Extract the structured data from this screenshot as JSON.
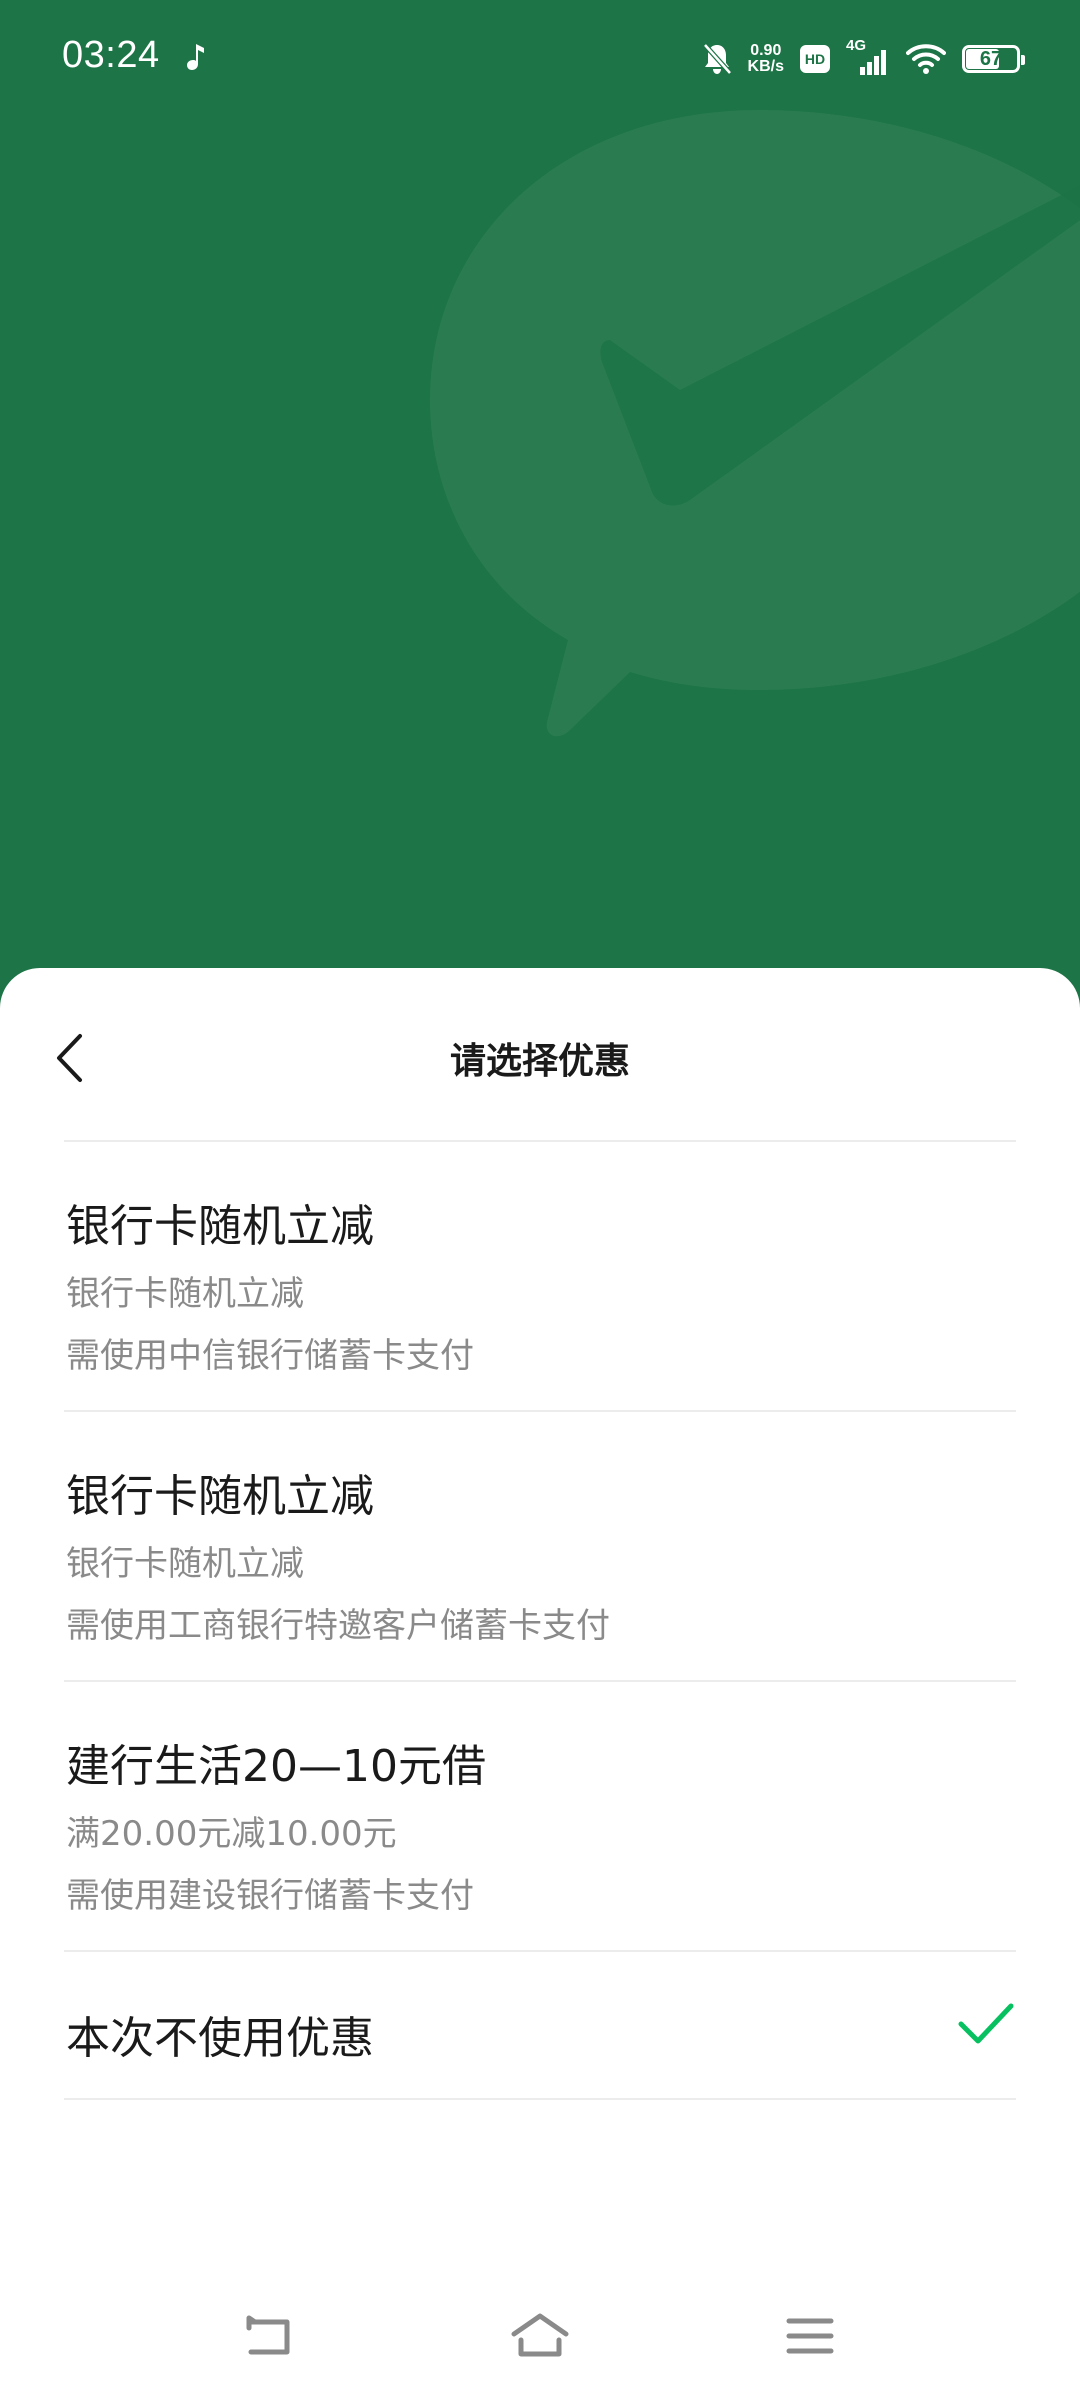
{
  "status_bar": {
    "time": "03:24",
    "net_speed_value": "0.90",
    "net_speed_unit": "KB/s",
    "hd": "HD",
    "network": "4G",
    "battery": "67",
    "battery_level": 0.67
  },
  "sheet": {
    "title": "请选择优惠"
  },
  "options": [
    {
      "title": "银行卡随机立减",
      "subtitle": "银行卡随机立减",
      "condition": "需使用中信银行储蓄卡支付"
    },
    {
      "title": "银行卡随机立减",
      "subtitle": "银行卡随机立减",
      "condition": "需使用工商银行特邀客户储蓄卡支付"
    },
    {
      "title": "建行生活20—10元借",
      "subtitle": "满20.00元减10.00元",
      "condition": "需使用建设银行储蓄卡支付"
    }
  ],
  "no_discount": {
    "title": "本次不使用优惠",
    "selected": true
  },
  "colors": {
    "brand_green": "#1d7446",
    "check_green": "#07c160"
  },
  "icons": {
    "back": "chevron-left-icon",
    "check": "check-icon",
    "nav_back": "nav-back-icon",
    "nav_home": "nav-home-icon",
    "nav_menu": "nav-menu-icon"
  }
}
